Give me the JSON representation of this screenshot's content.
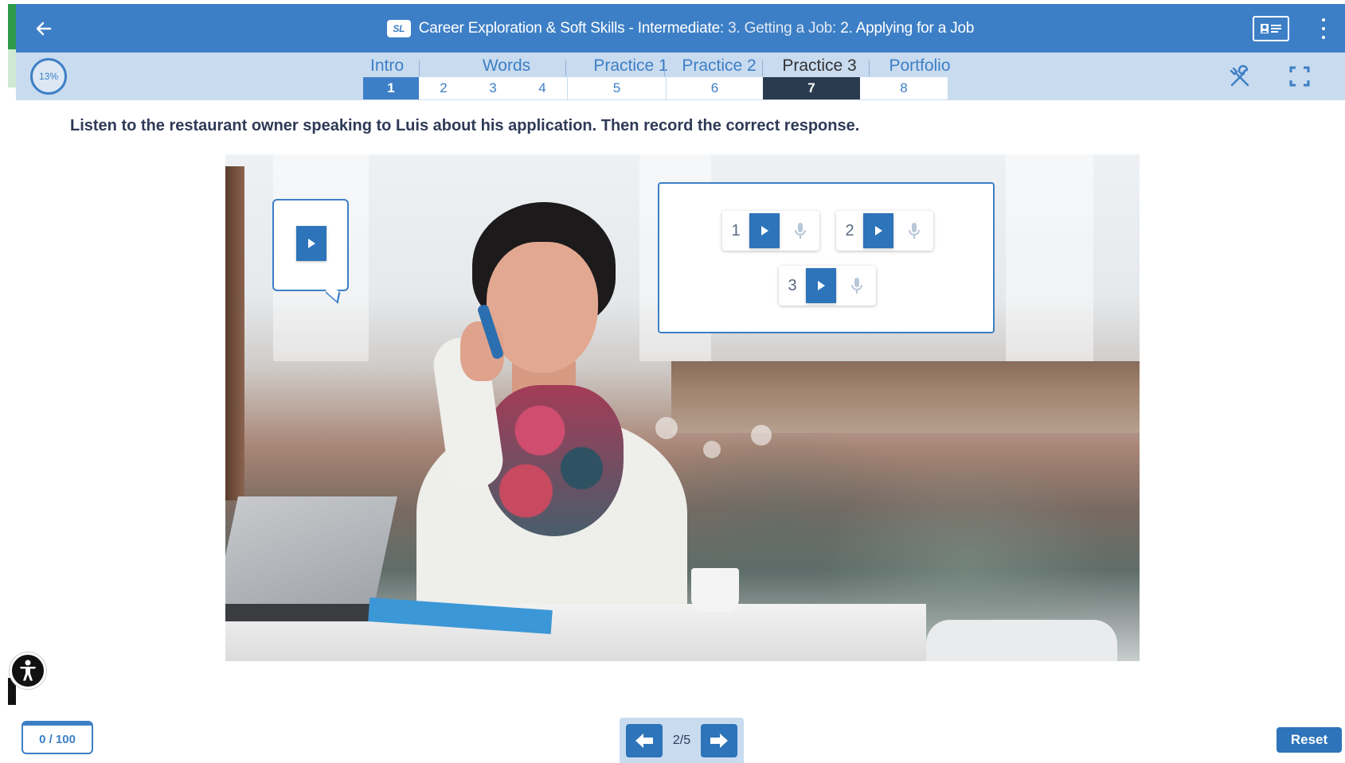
{
  "header": {
    "title_course": "Career Exploration & Soft Skills - Intermediate:",
    "title_unit": "3. Getting a Job:",
    "title_lesson": "2. Applying for a Job",
    "logo_text": "SL",
    "icons": {
      "back": "arrow-left-icon",
      "card": "id-card-icon",
      "menu": "more-vertical-icon"
    }
  },
  "nav": {
    "progress_label": "13%",
    "sections": [
      {
        "label": "Intro",
        "steps": [
          "1"
        ]
      },
      {
        "label": "Words",
        "steps": [
          "2",
          "3",
          "4"
        ]
      },
      {
        "label": "Practice 1",
        "steps": [
          "5"
        ]
      },
      {
        "label": "Practice 2",
        "steps": [
          "6"
        ]
      },
      {
        "label": "Practice 3",
        "steps": [
          "7"
        ]
      },
      {
        "label": "Portfolio",
        "steps": [
          "8"
        ]
      }
    ],
    "current_step": "1",
    "active_step": "7",
    "icons": {
      "tools": "tools-icon",
      "fullscreen": "fullscreen-icon"
    }
  },
  "activity": {
    "instruction": "Listen to the restaurant owner speaking to Luis about his application. Then record the correct response.",
    "responses": [
      {
        "number": "1"
      },
      {
        "number": "2"
      },
      {
        "number": "3"
      }
    ],
    "icons": {
      "play": "play-icon",
      "mic": "microphone-icon"
    }
  },
  "footer": {
    "score": "0 / 100",
    "page": "2/5",
    "reset_label": "Reset",
    "icons": {
      "prev": "arrow-left-icon",
      "next": "arrow-right-icon",
      "accessibility": "accessibility-icon"
    }
  },
  "colors": {
    "primary": "#3d7fc6",
    "nav_bg": "#c9dbef",
    "active_step": "#2a3b50",
    "button": "#2d74ba",
    "instruction_text": "#2f3a58"
  }
}
